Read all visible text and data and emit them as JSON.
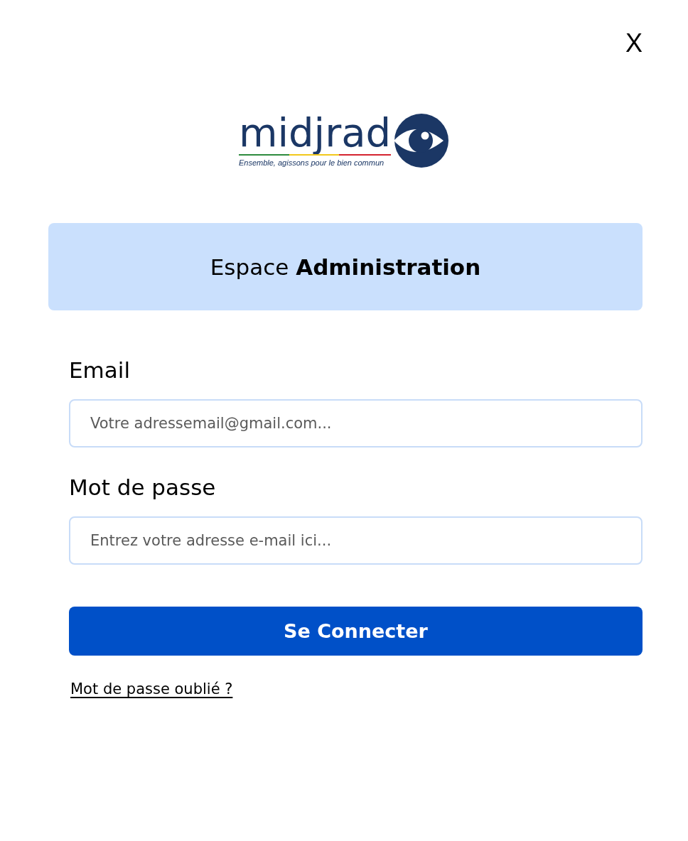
{
  "close_button": {
    "label": "X"
  },
  "logo": {
    "wordmark": "midjrad",
    "tagline": "Ensemble, agissons pour le bien commun"
  },
  "banner": {
    "title": "Espace **Administration**"
  },
  "form": {
    "fields": [
      {
        "label": "Email",
        "placeholder": "Votre adressemail@gmail.com..."
      },
      {
        "label": "Mot de passe",
        "placeholder": "Entrez votre adresse e-mail ici..."
      }
    ],
    "submit": {
      "label": "Se Connecter"
    },
    "forgot_link": {
      "label": "Mot de passe oublié ?"
    }
  }
}
